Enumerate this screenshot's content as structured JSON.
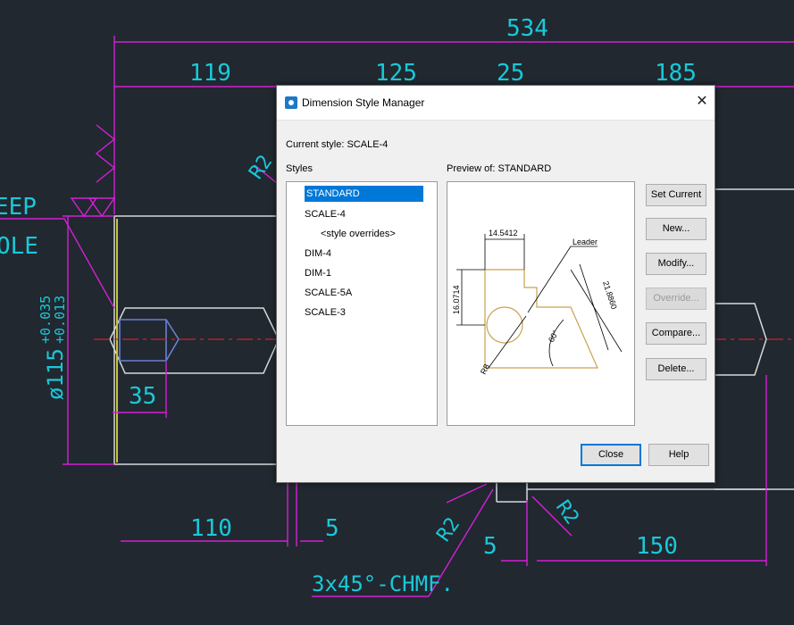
{
  "cad": {
    "dimensions": {
      "overall": "534",
      "d119": "119",
      "d125": "125",
      "d25": "25",
      "d185": "185",
      "d35": "35",
      "d110": "110",
      "d5a": "5",
      "d5b": "5",
      "d150": "150",
      "diameter": "ø115",
      "tol_upper": "+0.035",
      "tol_lower": "+0.013",
      "r2_top": "R2",
      "r2_left": "R2",
      "r2_right": "R2",
      "chamfer": "3x45°-CHMF.",
      "deep": "EEP",
      "hole": "OLE"
    },
    "colors": {
      "background": "#212830",
      "dimension_line": "#d61fd6",
      "dimension_text": "#19c9d9",
      "geometry": "#d8d8d8",
      "centerline": "#d0202a"
    }
  },
  "dialog": {
    "title": "Dimension Style Manager",
    "current_style_label": "Current style: SCALE-4",
    "styles_label": "Styles",
    "preview_label": "Preview of: STANDARD",
    "styles": [
      "STANDARD",
      "SCALE-4",
      "<style overrides>",
      "DIM-4",
      "DIM-1",
      "SCALE-5A",
      "SCALE-3"
    ],
    "selected_style": "STANDARD",
    "buttons": {
      "set_current": "Set Current",
      "new": "New...",
      "modify": "Modify...",
      "override": "Override...",
      "compare": "Compare...",
      "delete": "Delete...",
      "close": "Close",
      "help": "Help"
    },
    "preview": {
      "dim_top": "14.5412",
      "dim_left": "16.0714",
      "dim_diag": "21.8860",
      "leader": "Leader",
      "angle": "60°",
      "radius": "R8"
    },
    "colors": {
      "selection": "#0078d7",
      "preview_outline": "#c9a24e"
    }
  }
}
